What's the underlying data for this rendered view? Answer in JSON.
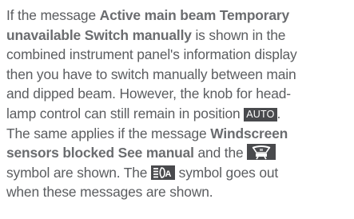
{
  "paragraph": {
    "l1_a": "If the message ",
    "l1_b": "Active main beam Temporary",
    "l2_a": "unavailable Switch manually",
    "l2_b": " is shown in the",
    "l3": "combined instrument panel's information display",
    "l4": "then you have to switch manually between main",
    "l5": "and dipped beam. However, the knob for head-",
    "l6_a": "lamp control can still remain in position ",
    "auto_badge": "AUTO",
    "l6_b": ".",
    "l7_a": "The same applies if the message ",
    "l7_b": "Windscreen",
    "l8_a": "sensors blocked See manual",
    "l8_b": " and the ",
    "l9": "symbol are shown. The ",
    "l9_b": " symbol goes out",
    "l10": "when these messages are shown."
  },
  "icons": {
    "windscreen_symbol": "windscreen-sensor-icon",
    "main_beam_symbol": "active-main-beam-icon"
  },
  "colors": {
    "text": "#5b5d60",
    "bold_text": "#6a6c6f",
    "badge_background": "#494a4d",
    "badge_text": "#ffffff"
  }
}
